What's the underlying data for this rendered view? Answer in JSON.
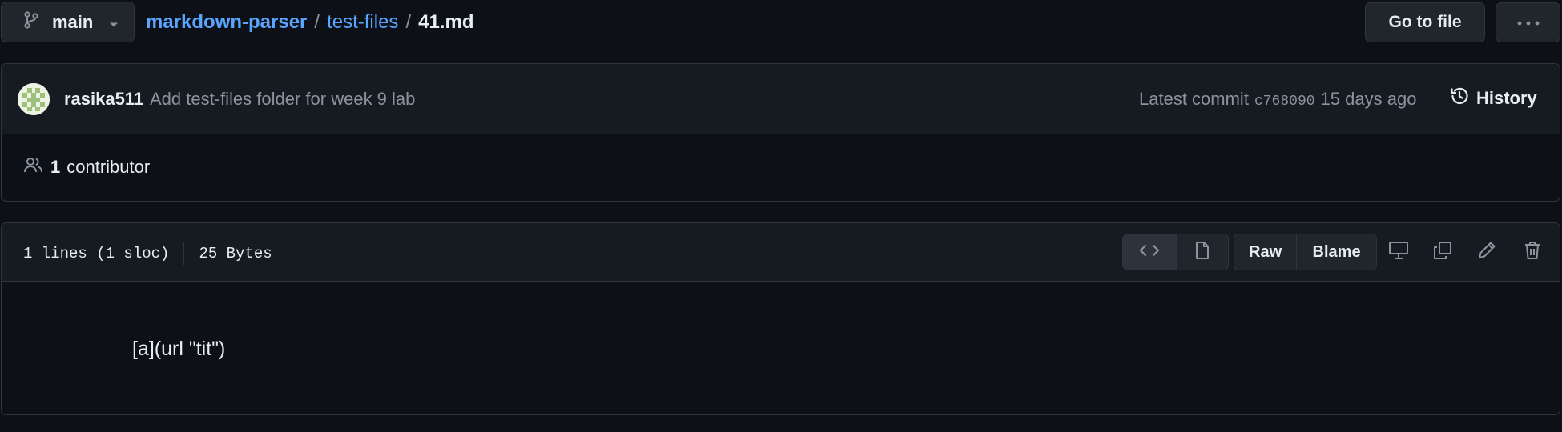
{
  "header": {
    "branch": "main",
    "breadcrumb": {
      "repo": "markdown-parser",
      "separator": "/",
      "folder": "test-files",
      "file": "41.md"
    },
    "goto_file": "Go to file",
    "more_label": "···"
  },
  "commit": {
    "author": "rasika511",
    "message": "Add test-files folder for week 9 lab",
    "latest_prefix": "Latest commit",
    "sha": "c768090",
    "time": "15 days ago",
    "history": "History"
  },
  "contributors": {
    "count": "1",
    "label": "contributor"
  },
  "file": {
    "lines": "1 lines (1 sloc)",
    "size": "25 Bytes",
    "raw": "Raw",
    "blame": "Blame",
    "content": "[a](url \"tit\")"
  },
  "colors": {
    "background": "#0d1117",
    "panel": "#161b22",
    "border": "#30363d",
    "link": "#58a6ff",
    "muted": "#8b949e",
    "text": "#e6edf3"
  }
}
